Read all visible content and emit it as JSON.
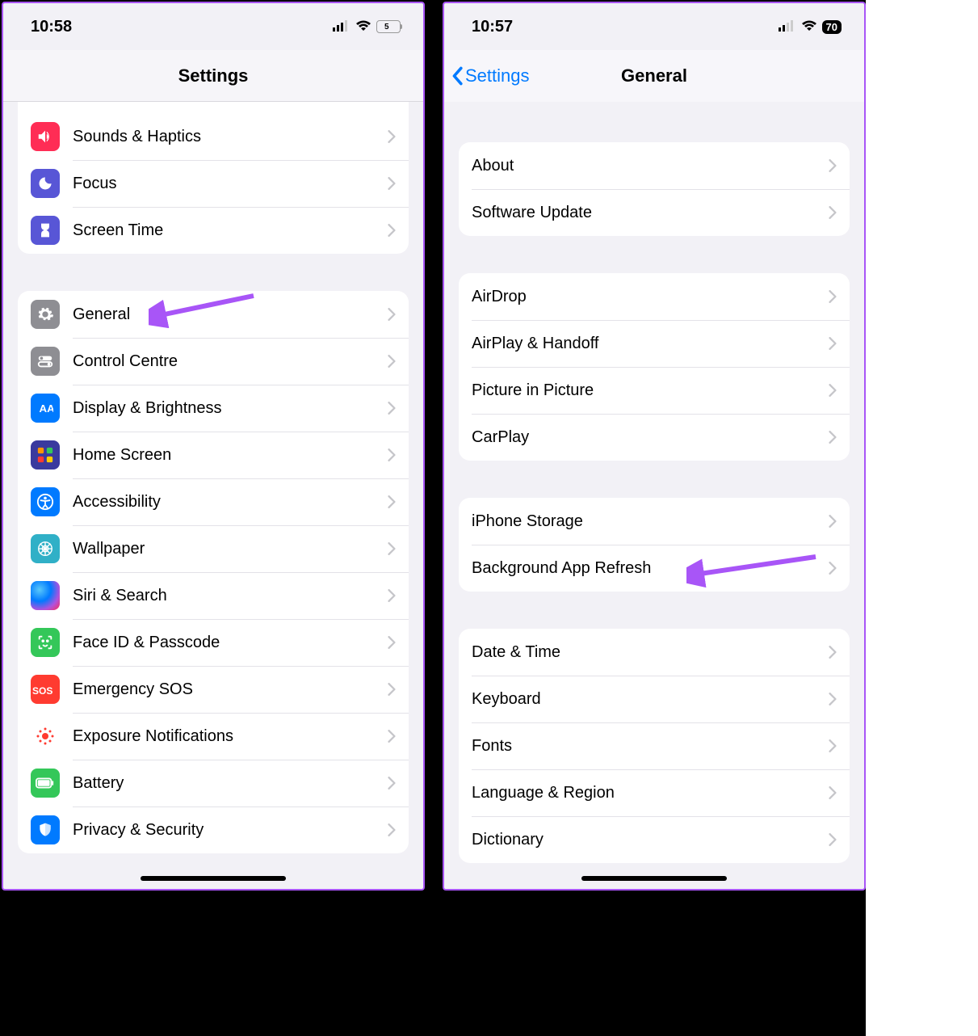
{
  "left": {
    "status": {
      "time": "10:58",
      "battery": "5"
    },
    "title": "Settings",
    "group1": [
      {
        "name": "sounds-haptics",
        "label": "Sounds & Haptics",
        "color": "#ff2d55"
      },
      {
        "name": "focus",
        "label": "Focus",
        "color": "#5856d6"
      },
      {
        "name": "screen-time",
        "label": "Screen Time",
        "color": "#5856d6"
      }
    ],
    "group2": [
      {
        "name": "general",
        "label": "General",
        "color": "#8e8e93"
      },
      {
        "name": "control-centre",
        "label": "Control Centre",
        "color": "#8e8e93"
      },
      {
        "name": "display-brightness",
        "label": "Display & Brightness",
        "color": "#007aff"
      },
      {
        "name": "home-screen",
        "label": "Home Screen",
        "color": "#3a3a9e"
      },
      {
        "name": "accessibility",
        "label": "Accessibility",
        "color": "#007aff"
      },
      {
        "name": "wallpaper",
        "label": "Wallpaper",
        "color": "#30b0c7"
      },
      {
        "name": "siri-search",
        "label": "Siri & Search",
        "color": ""
      },
      {
        "name": "face-id",
        "label": "Face ID & Passcode",
        "color": "#34c759"
      },
      {
        "name": "emergency-sos",
        "label": "Emergency SOS",
        "color": "#ff3b30"
      },
      {
        "name": "exposure-notifications",
        "label": "Exposure Notifications",
        "color": "#ffffff"
      },
      {
        "name": "battery",
        "label": "Battery",
        "color": "#34c759"
      },
      {
        "name": "privacy-security",
        "label": "Privacy & Security",
        "color": "#007aff"
      }
    ]
  },
  "right": {
    "status": {
      "time": "10:57",
      "battery": "70"
    },
    "back": "Settings",
    "title": "General",
    "group1": [
      {
        "name": "about",
        "label": "About"
      },
      {
        "name": "software-update",
        "label": "Software Update"
      }
    ],
    "group2": [
      {
        "name": "airdrop",
        "label": "AirDrop"
      },
      {
        "name": "airplay-handoff",
        "label": "AirPlay & Handoff"
      },
      {
        "name": "picture-in-picture",
        "label": "Picture in Picture"
      },
      {
        "name": "carplay",
        "label": "CarPlay"
      }
    ],
    "group3": [
      {
        "name": "iphone-storage",
        "label": "iPhone Storage"
      },
      {
        "name": "background-app-refresh",
        "label": "Background App Refresh"
      }
    ],
    "group4": [
      {
        "name": "date-time",
        "label": "Date & Time"
      },
      {
        "name": "keyboard",
        "label": "Keyboard"
      },
      {
        "name": "fonts",
        "label": "Fonts"
      },
      {
        "name": "language-region",
        "label": "Language & Region"
      },
      {
        "name": "dictionary",
        "label": "Dictionary"
      }
    ]
  }
}
